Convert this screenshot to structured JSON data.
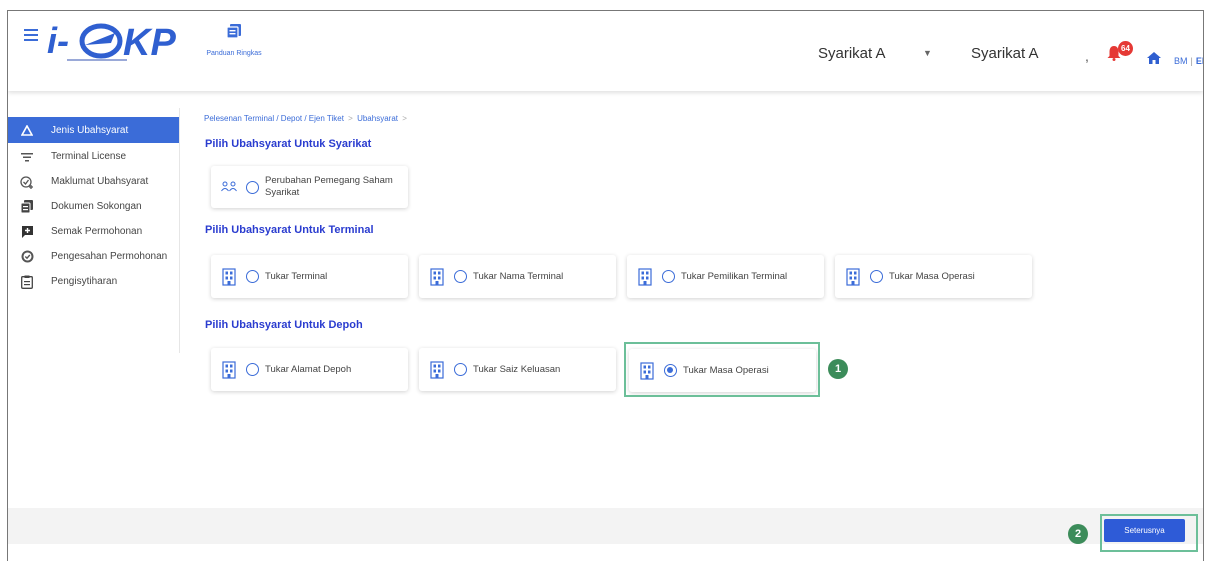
{
  "header": {
    "logo_text": "i-SPKP",
    "guide_label": "Panduan Ringkas",
    "company_selector": "Syarikat A",
    "company_name": "Syarikat A",
    "comma": ",",
    "notification_count": "64",
    "lang_bm": "BM",
    "lang_sep": "|",
    "lang_en": "EN"
  },
  "sidebar": {
    "items": [
      {
        "label": "Jenis Ubahsyarat",
        "icon": "triangle-icon",
        "active": true
      },
      {
        "label": "Terminal License",
        "icon": "filter-icon"
      },
      {
        "label": "Maklumat Ubahsyarat",
        "icon": "check-add-icon"
      },
      {
        "label": "Dokumen Sokongan",
        "icon": "document-icon"
      },
      {
        "label": "Semak Permohonan",
        "icon": "message-add-icon"
      },
      {
        "label": "Pengesahan Permohonan",
        "icon": "check-circle-icon"
      },
      {
        "label": "Pengisytiharan",
        "icon": "clipboard-icon"
      }
    ]
  },
  "breadcrumb": {
    "path": "Pelesenan Terminal / Depot / Ejen Tiket",
    "arrow": ">",
    "current": "Ubahsyarat"
  },
  "sections": [
    {
      "title": "Pilih Ubahsyarat Untuk Syarikat",
      "options": [
        {
          "label_line1": "Perubahan Pemegang Saham",
          "label_line2": "Syarikat",
          "selected": false
        }
      ]
    },
    {
      "title": "Pilih Ubahsyarat Untuk Terminal",
      "options": [
        {
          "label": "Tukar Terminal",
          "selected": false
        },
        {
          "label": "Tukar Nama Terminal",
          "selected": false
        },
        {
          "label": "Tukar Pemilikan Terminal",
          "selected": false
        },
        {
          "label": "Tukar Masa Operasi",
          "selected": false
        }
      ]
    },
    {
      "title": "Pilih Ubahsyarat Untuk Depoh",
      "options": [
        {
          "label": "Tukar Alamat Depoh",
          "selected": false
        },
        {
          "label": "Tukar Saiz Keluasan",
          "selected": false
        },
        {
          "label": "Tukar Masa Operasi",
          "selected": true
        }
      ]
    }
  ],
  "annotations": {
    "step1": "1",
    "step2": "2"
  },
  "footer": {
    "next_label": "Seterusnya"
  },
  "colors": {
    "primary": "#3b6cd8",
    "section_title": "#2a3ccf",
    "highlight_border": "#6cbf99",
    "step_badge": "#3c8c5a",
    "notification_badge": "#e53935"
  }
}
